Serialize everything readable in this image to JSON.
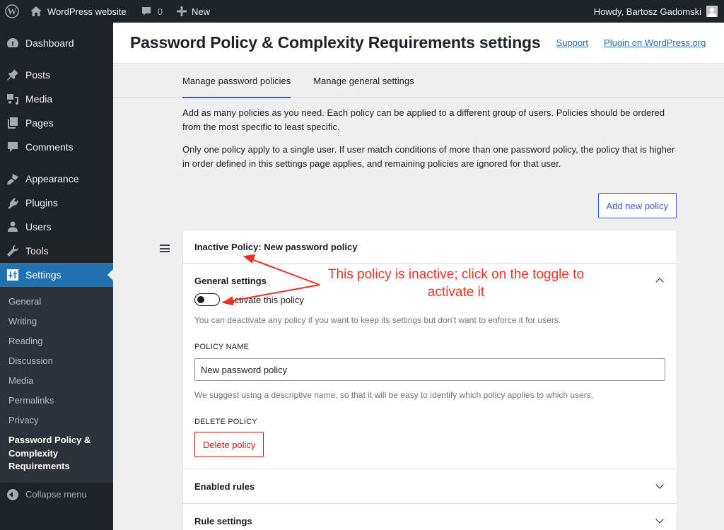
{
  "admin_bar": {
    "wp_logo_icon": "wordpress-logo-icon",
    "site_name": "WordPress website",
    "comments_count": "0",
    "new_label": "New",
    "greeting": "Howdy, Bartosz Gadomski"
  },
  "sidebar": {
    "items": [
      {
        "label": "Dashboard",
        "icon": "dashboard-icon"
      },
      {
        "label": "Posts",
        "icon": "pin-icon"
      },
      {
        "label": "Media",
        "icon": "media-icon"
      },
      {
        "label": "Pages",
        "icon": "pages-icon"
      },
      {
        "label": "Comments",
        "icon": "comment-icon"
      },
      {
        "label": "Appearance",
        "icon": "brush-icon"
      },
      {
        "label": "Plugins",
        "icon": "plugin-icon"
      },
      {
        "label": "Users",
        "icon": "user-icon"
      },
      {
        "label": "Tools",
        "icon": "wrench-icon"
      },
      {
        "label": "Settings",
        "icon": "sliders-icon",
        "active": true
      }
    ],
    "submenu": [
      {
        "label": "General"
      },
      {
        "label": "Writing"
      },
      {
        "label": "Reading"
      },
      {
        "label": "Discussion"
      },
      {
        "label": "Media"
      },
      {
        "label": "Permalinks"
      },
      {
        "label": "Privacy"
      },
      {
        "label": "Password Policy & Complexity Requirements",
        "current": true
      }
    ],
    "collapse_label": "Collapse menu"
  },
  "header": {
    "title": "Password Policy & Complexity Requirements settings",
    "links": [
      "Support",
      "Plugin on WordPress.org"
    ]
  },
  "tabs": [
    {
      "label": "Manage password policies",
      "active": true
    },
    {
      "label": "Manage general settings",
      "active": false
    }
  ],
  "content": {
    "description_1": "Add as many policies as you need. Each policy can be applied to a different group of users. Policies should be ordered from the most specific to least specific.",
    "description_2": "Only one policy apply to a single user. If user match conditions of more than one password policy, the policy that is higher in order defined in this settings page applies, and remaining policies are ignored for that user.",
    "add_button": "Add new policy",
    "policy": {
      "title": "Inactive Policy: New password policy",
      "general_settings": {
        "title": "General settings",
        "expanded": true,
        "toggle_label": "Activate this policy",
        "toggle_on": false,
        "toggle_help": "You can deactivate any policy if you want to keep its settings but don't want to enforce it for users.",
        "name_label": "POLICY NAME",
        "name_value": "New password policy",
        "name_help": "We suggest using a descriptive name, so that it will be easy to identify which policy applies to which users.",
        "delete_label": "DELETE POLICY",
        "delete_button": "Delete policy"
      },
      "panels": [
        {
          "title": "Enabled rules",
          "expanded": false
        },
        {
          "title": "Rule settings",
          "expanded": false
        }
      ]
    }
  },
  "annotation": {
    "text": "This policy is inactive; click on the toggle to activate it",
    "color": "#ee3124"
  },
  "colors": {
    "admin_bg": "#1d2327",
    "accent": "#2271b1",
    "tab_accent": "#3858e9",
    "danger": "#cc1818"
  }
}
